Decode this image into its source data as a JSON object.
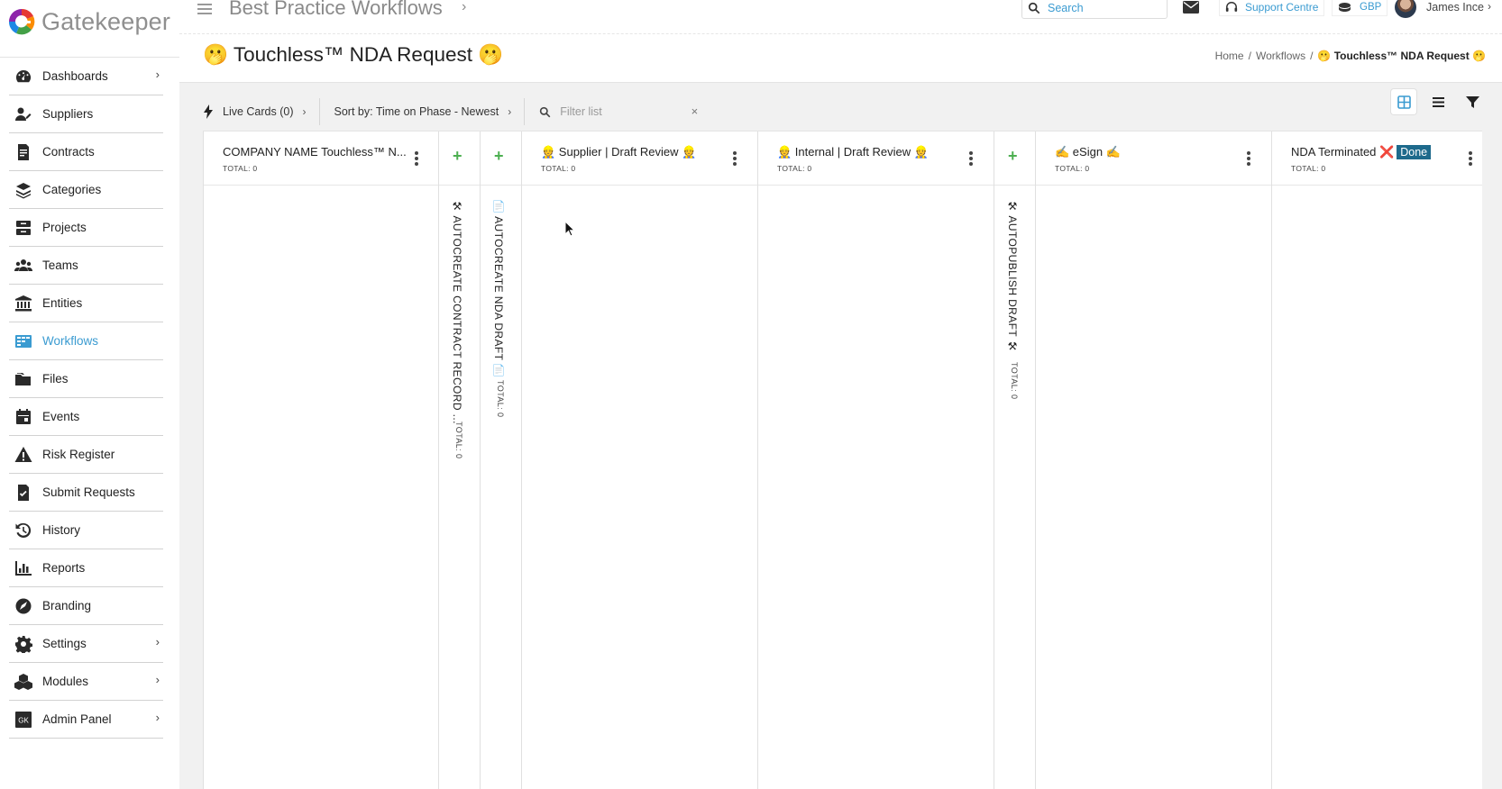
{
  "brand": {
    "name": "Gatekeeper"
  },
  "sidebar": {
    "items": [
      {
        "label": "Dashboards",
        "icon": "dashboard-icon",
        "has_chevron": true
      },
      {
        "label": "Suppliers",
        "icon": "supplier-icon",
        "has_chevron": false
      },
      {
        "label": "Contracts",
        "icon": "contract-icon",
        "has_chevron": false
      },
      {
        "label": "Categories",
        "icon": "layers-icon",
        "has_chevron": false
      },
      {
        "label": "Projects",
        "icon": "projects-icon",
        "has_chevron": false
      },
      {
        "label": "Teams",
        "icon": "users-icon",
        "has_chevron": false
      },
      {
        "label": "Entities",
        "icon": "bank-icon",
        "has_chevron": false
      },
      {
        "label": "Workflows",
        "icon": "workflows-icon",
        "has_chevron": false,
        "active": true
      },
      {
        "label": "Files",
        "icon": "files-icon",
        "has_chevron": false
      },
      {
        "label": "Events",
        "icon": "calendar-icon",
        "has_chevron": false
      },
      {
        "label": "Risk Register",
        "icon": "warning-icon",
        "has_chevron": false
      },
      {
        "label": "Submit Requests",
        "icon": "submit-icon",
        "has_chevron": false
      },
      {
        "label": "History",
        "icon": "history-icon",
        "has_chevron": false
      },
      {
        "label": "Reports",
        "icon": "reports-icon",
        "has_chevron": false
      },
      {
        "label": "Branding",
        "icon": "branding-icon",
        "has_chevron": false
      },
      {
        "label": "Settings",
        "icon": "gear-icon",
        "has_chevron": true
      },
      {
        "label": "Modules",
        "icon": "modules-icon",
        "has_chevron": true
      },
      {
        "label": "Admin Panel",
        "icon": "gk-icon",
        "has_chevron": true
      }
    ]
  },
  "topbar": {
    "workflow_title": "Best Practice Workflows",
    "search_placeholder": "Search",
    "support_label": "Support Centre",
    "currency": "GBP",
    "user_name": "James Ince"
  },
  "page": {
    "title": "🫢 Touchless™ NDA Request 🫢",
    "breadcrumb": [
      "Home",
      "Workflows",
      "🫢 Touchless™ NDA Request 🫢"
    ]
  },
  "toolbar": {
    "live_cards": "Live Cards (0)",
    "sort": "Sort by: Time on Phase - Newest",
    "filter_placeholder": "Filter list",
    "clear": "×"
  },
  "board": {
    "columns": [
      {
        "name": "COMPANY NAME Touchless™ N...",
        "total": "TOTAL: 0"
      },
      {
        "name": "👷 Supplier | Draft Review 👷",
        "total": "TOTAL: 0"
      },
      {
        "name": "👷 Internal | Draft Review 👷",
        "total": "TOTAL: 0"
      },
      {
        "name": "✍️ eSign ✍️",
        "total": "TOTAL: 0"
      },
      {
        "name": "NDA Terminated",
        "done": "Done",
        "x": "❌",
        "total": "TOTAL: 0"
      }
    ],
    "automations": [
      {
        "name": "⚒ AUTOCREATE CONTRACT RECORD ...",
        "total": "TOTAL: 0",
        "add": "+"
      },
      {
        "name": "📄 AUTOCREATE NDA DRAFT 📄",
        "total": "TOTAL: 0",
        "add": "+"
      },
      {
        "name": "⚒ AUTOPUBLISH DRAFT ⚒",
        "total": "TOTAL: 0",
        "add": "+"
      }
    ]
  },
  "colors": {
    "accent": "#3a9bd1",
    "done_badge": "#1e6a8c",
    "plus_green": "#4caf50"
  }
}
